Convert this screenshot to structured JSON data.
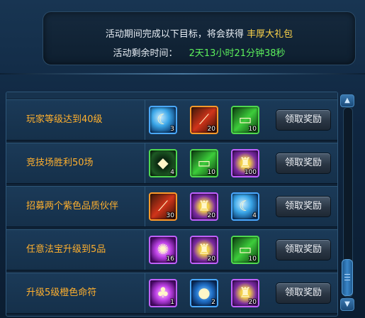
{
  "header": {
    "line1_prefix": "活动期间完成以下目标，将会获得",
    "line1_highlight": "丰厚大礼包",
    "timer_label": "活动剩余时间：",
    "timer_value": "2天13小时21分钟38秒"
  },
  "rows": [
    {
      "task": "玩家等级达到40级",
      "button": "领取奖励",
      "rewards": [
        {
          "icon": "blue-moon-orb-icon",
          "count": "3",
          "quality": "blue"
        },
        {
          "icon": "red-stripe-scroll-icon",
          "count": "20",
          "quality": "orange"
        },
        {
          "icon": "green-scroll-icon",
          "count": "10",
          "quality": "green"
        }
      ]
    },
    {
      "task": "竞技场胜利50场",
      "button": "领取奖励",
      "rewards": [
        {
          "icon": "green-crystal-icon",
          "count": "4",
          "quality": "green2"
        },
        {
          "icon": "green-scroll-icon",
          "count": "10",
          "quality": "green"
        },
        {
          "icon": "gold-talisman-icon",
          "count": "100",
          "quality": "purple"
        }
      ]
    },
    {
      "task": "招募两个紫色品质伙伴",
      "button": "领取奖励",
      "rewards": [
        {
          "icon": "red-stripe-scroll-icon",
          "count": "30",
          "quality": "orange"
        },
        {
          "icon": "gold-talisman-icon",
          "count": "20",
          "quality": "purple"
        },
        {
          "icon": "blue-moon-orb-icon",
          "count": "4",
          "quality": "blue"
        }
      ]
    },
    {
      "task": "任意法宝升级到5品",
      "button": "领取奖励",
      "rewards": [
        {
          "icon": "purple-rune-orb-icon",
          "count": "16",
          "quality": "purple2"
        },
        {
          "icon": "gold-talisman-icon",
          "count": "20",
          "quality": "purple"
        },
        {
          "icon": "green-scroll-icon",
          "count": "10",
          "quality": "green"
        }
      ]
    },
    {
      "task": "升级5级橙色命符",
      "button": "领取奖励",
      "rewards": [
        {
          "icon": "purple-gift-bag-icon",
          "count": "1",
          "quality": "purple2"
        },
        {
          "icon": "blue-potion-icon",
          "count": "2",
          "quality": "blue2"
        },
        {
          "icon": "gold-talisman-icon",
          "count": "20",
          "quality": "purple"
        }
      ]
    }
  ],
  "scrollbar": {
    "up": "▲",
    "down": "▼"
  },
  "colors": {
    "task_text": "#ffb02e",
    "highlight": "#ffd54a",
    "timer": "#5cf05c"
  }
}
